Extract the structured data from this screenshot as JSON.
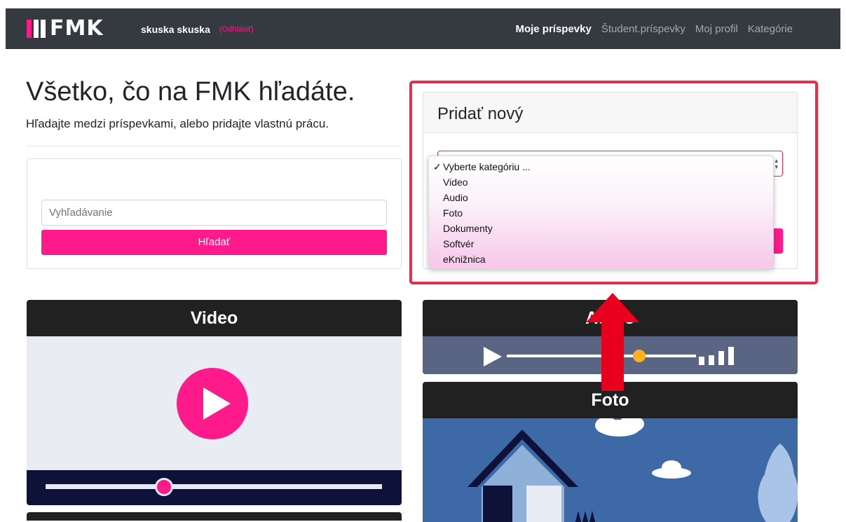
{
  "navbar": {
    "brand": "FMK",
    "user": "skuska skuska",
    "logout": "(Odhlásiť)",
    "links": [
      {
        "label": "Moje príspevky",
        "active": true
      },
      {
        "label": "Študent.príspevky",
        "active": false
      },
      {
        "label": "Moj profil",
        "active": false
      },
      {
        "label": "Kategórie",
        "active": false
      }
    ]
  },
  "hero": {
    "title": "Všetko, čo na FMK hľadáte.",
    "subtitle": "Hľadajte medzi príspevkami, alebo pridajte vlastnú prácu."
  },
  "search": {
    "placeholder": "Vyhľadávanie",
    "button_label": "Hľadať"
  },
  "add_new": {
    "title": "Pridať nový",
    "select": {
      "selected": "Vyberte kategóriu ...",
      "check_glyph": "✓",
      "options": [
        "Vyberte kategóriu ...",
        "Video",
        "Audio",
        "Foto",
        "Dokumenty",
        "Softvér",
        "eKnižnica"
      ]
    }
  },
  "tiles": {
    "video": "Video",
    "audio": "Audio",
    "photo": "Foto"
  },
  "colors": {
    "accent": "#ff1a8c",
    "navbar": "#343a40",
    "highlight": "#e0304f",
    "annotation_arrow": "#e8001c"
  },
  "icons": {
    "video_play": "play-icon",
    "audio_play": "play-icon",
    "annotation": "up-arrow-icon"
  }
}
